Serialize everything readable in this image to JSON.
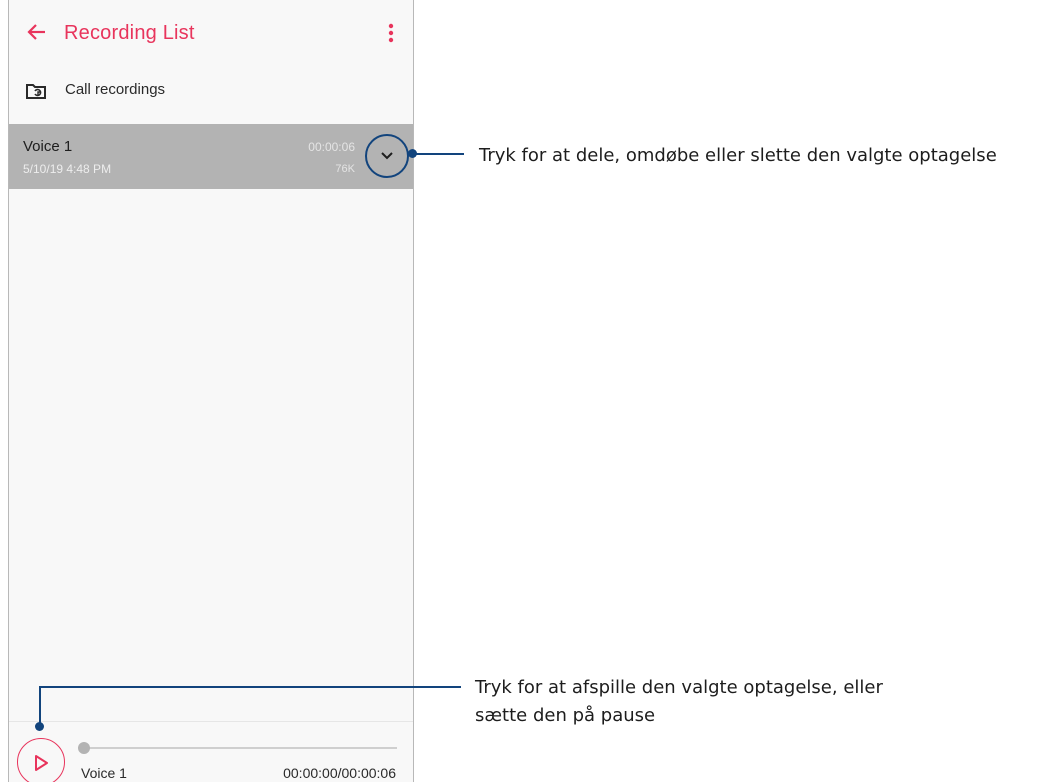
{
  "app_bar": {
    "title": "Recording List",
    "back_icon": "arrow-left-icon",
    "menu_icon": "more-vertical-icon",
    "accent_color": "#e8345c"
  },
  "folder": {
    "icon": "folder-sync-icon",
    "label": "Call recordings"
  },
  "recordings": [
    {
      "name": "Voice 1",
      "date": "5/10/19 4:48 PM",
      "duration": "00:00:06",
      "size": "76K",
      "selected": true,
      "expand_icon": "chevron-down-icon"
    }
  ],
  "player": {
    "play_icon": "play-icon",
    "name": "Voice 1",
    "time": "00:00:00/00:00:06",
    "progress": 0
  },
  "callouts": {
    "expand_label": "Tryk for at dele, omdøbe eller slette den valgte optagelse",
    "play_label_line1": "Tryk for at afspille den valgte optagelse, eller",
    "play_label_line2": "sætte den på pause",
    "line_color": "#12447d"
  }
}
